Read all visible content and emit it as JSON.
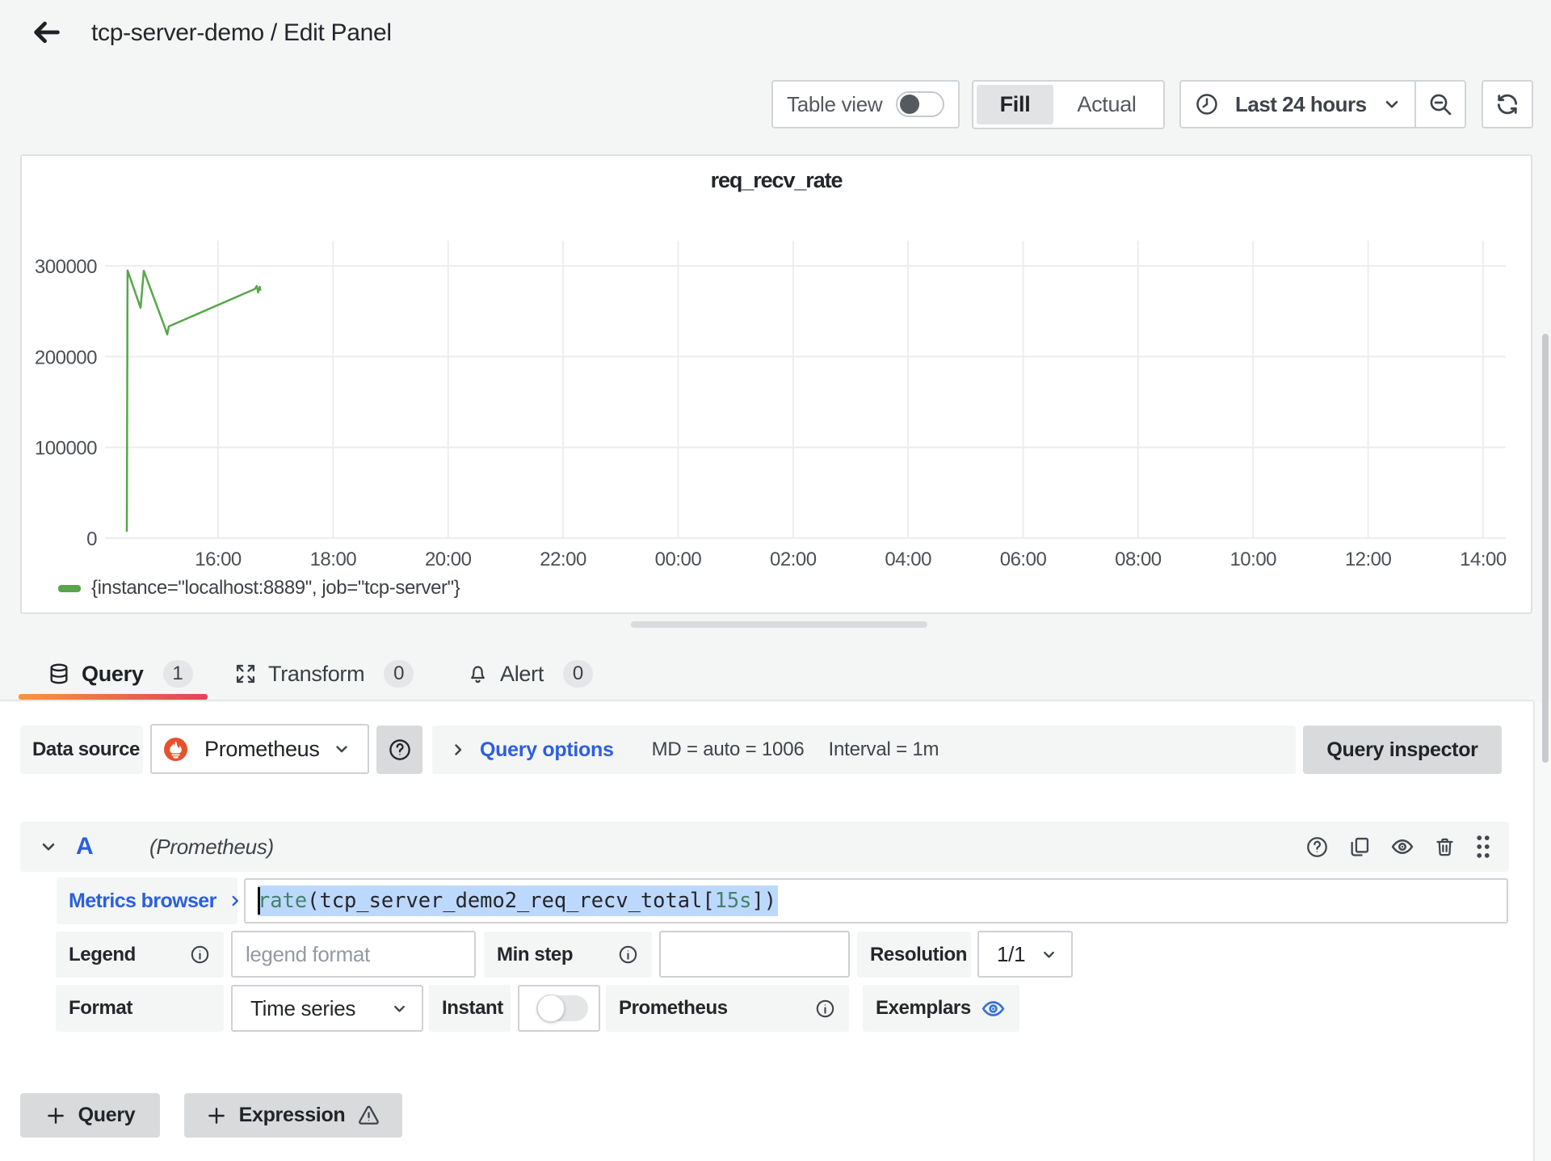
{
  "header": {
    "title": "tcp-server-demo / Edit Panel"
  },
  "toolbar": {
    "table_view_label": "Table view",
    "fill_label": "Fill",
    "actual_label": "Actual",
    "time_range_label": "Last 24 hours"
  },
  "panel": {
    "title": "req_recv_rate",
    "legend": "{instance=\"localhost:8889\", job=\"tcp-server\"}"
  },
  "chart_data": {
    "type": "line",
    "title": "req_recv_rate",
    "xlabel": "",
    "ylabel": "",
    "ylim": [
      0,
      327000
    ],
    "grid": true,
    "legend_position": "bottom-left",
    "x_ticks": [
      {
        "h": 16,
        "label": "16:00"
      },
      {
        "h": 18,
        "label": "18:00"
      },
      {
        "h": 20,
        "label": "20:00"
      },
      {
        "h": 22,
        "label": "22:00"
      },
      {
        "h": 24,
        "label": "00:00"
      },
      {
        "h": 26,
        "label": "02:00"
      },
      {
        "h": 28,
        "label": "04:00"
      },
      {
        "h": 30,
        "label": "06:00"
      },
      {
        "h": 32,
        "label": "08:00"
      },
      {
        "h": 34,
        "label": "10:00"
      },
      {
        "h": 36,
        "label": "12:00"
      },
      {
        "h": 38,
        "label": "14:00"
      }
    ],
    "y_ticks": [
      {
        "v": 0,
        "label": "0"
      },
      {
        "v": 100000,
        "label": "100000"
      },
      {
        "v": 200000,
        "label": "200000"
      },
      {
        "v": 300000,
        "label": "300000"
      }
    ],
    "series": [
      {
        "name": "{instance=\"localhost:8889\", job=\"tcp-server\"}",
        "color": "#57a64a",
        "points": [
          [
            14.413,
            7000
          ],
          [
            14.425,
            295000
          ],
          [
            14.651,
            253800
          ],
          [
            14.707,
            294700
          ],
          [
            15.073,
            232400
          ],
          [
            15.115,
            224400
          ],
          [
            15.143,
            233300
          ],
          [
            16.64,
            274600
          ],
          [
            16.672,
            277800
          ],
          [
            16.697,
            270700
          ],
          [
            16.722,
            277000
          ],
          [
            16.737,
            272800
          ]
        ]
      }
    ]
  },
  "tabs": [
    {
      "label": "Query",
      "count": "1"
    },
    {
      "label": "Transform",
      "count": "0"
    },
    {
      "label": "Alert",
      "count": "0"
    }
  ],
  "datasource_row": {
    "label": "Data source",
    "value": "Prometheus",
    "query_options_label": "Query options",
    "md_text": "MD = auto = 1006",
    "interval_text": "Interval = 1m",
    "inspector_label": "Query inspector"
  },
  "query_row": {
    "ref_id": "A",
    "datasource_hint": "(Prometheus)",
    "metrics_browser_label": "Metrics browser",
    "query_tokens": [
      {
        "text": "rate",
        "type": "k"
      },
      {
        "text": "(tcp_server_demo2_req_recv_total[",
        "type": "p"
      },
      {
        "text": "15s",
        "type": "k"
      },
      {
        "text": "])",
        "type": "p"
      }
    ],
    "legend_label": "Legend",
    "legend_placeholder": "legend format",
    "min_step_label": "Min step",
    "resolution_label": "Resolution",
    "resolution_value": "1/1",
    "format_label": "Format",
    "format_value": "Time series",
    "instant_label": "Instant",
    "prometheus_label": "Prometheus",
    "exemplars_label": "Exemplars"
  },
  "actions": {
    "add_query_label": "Query",
    "add_expression_label": "Expression"
  },
  "colors": {
    "accent_blue": "#2b5fe0",
    "series_green": "#57a64a",
    "tab_gradient_start": "#f7953e",
    "tab_gradient_end": "#e5415a",
    "prometheus_orange": "#e6522c",
    "selection_blue": "#bdd8fd"
  }
}
